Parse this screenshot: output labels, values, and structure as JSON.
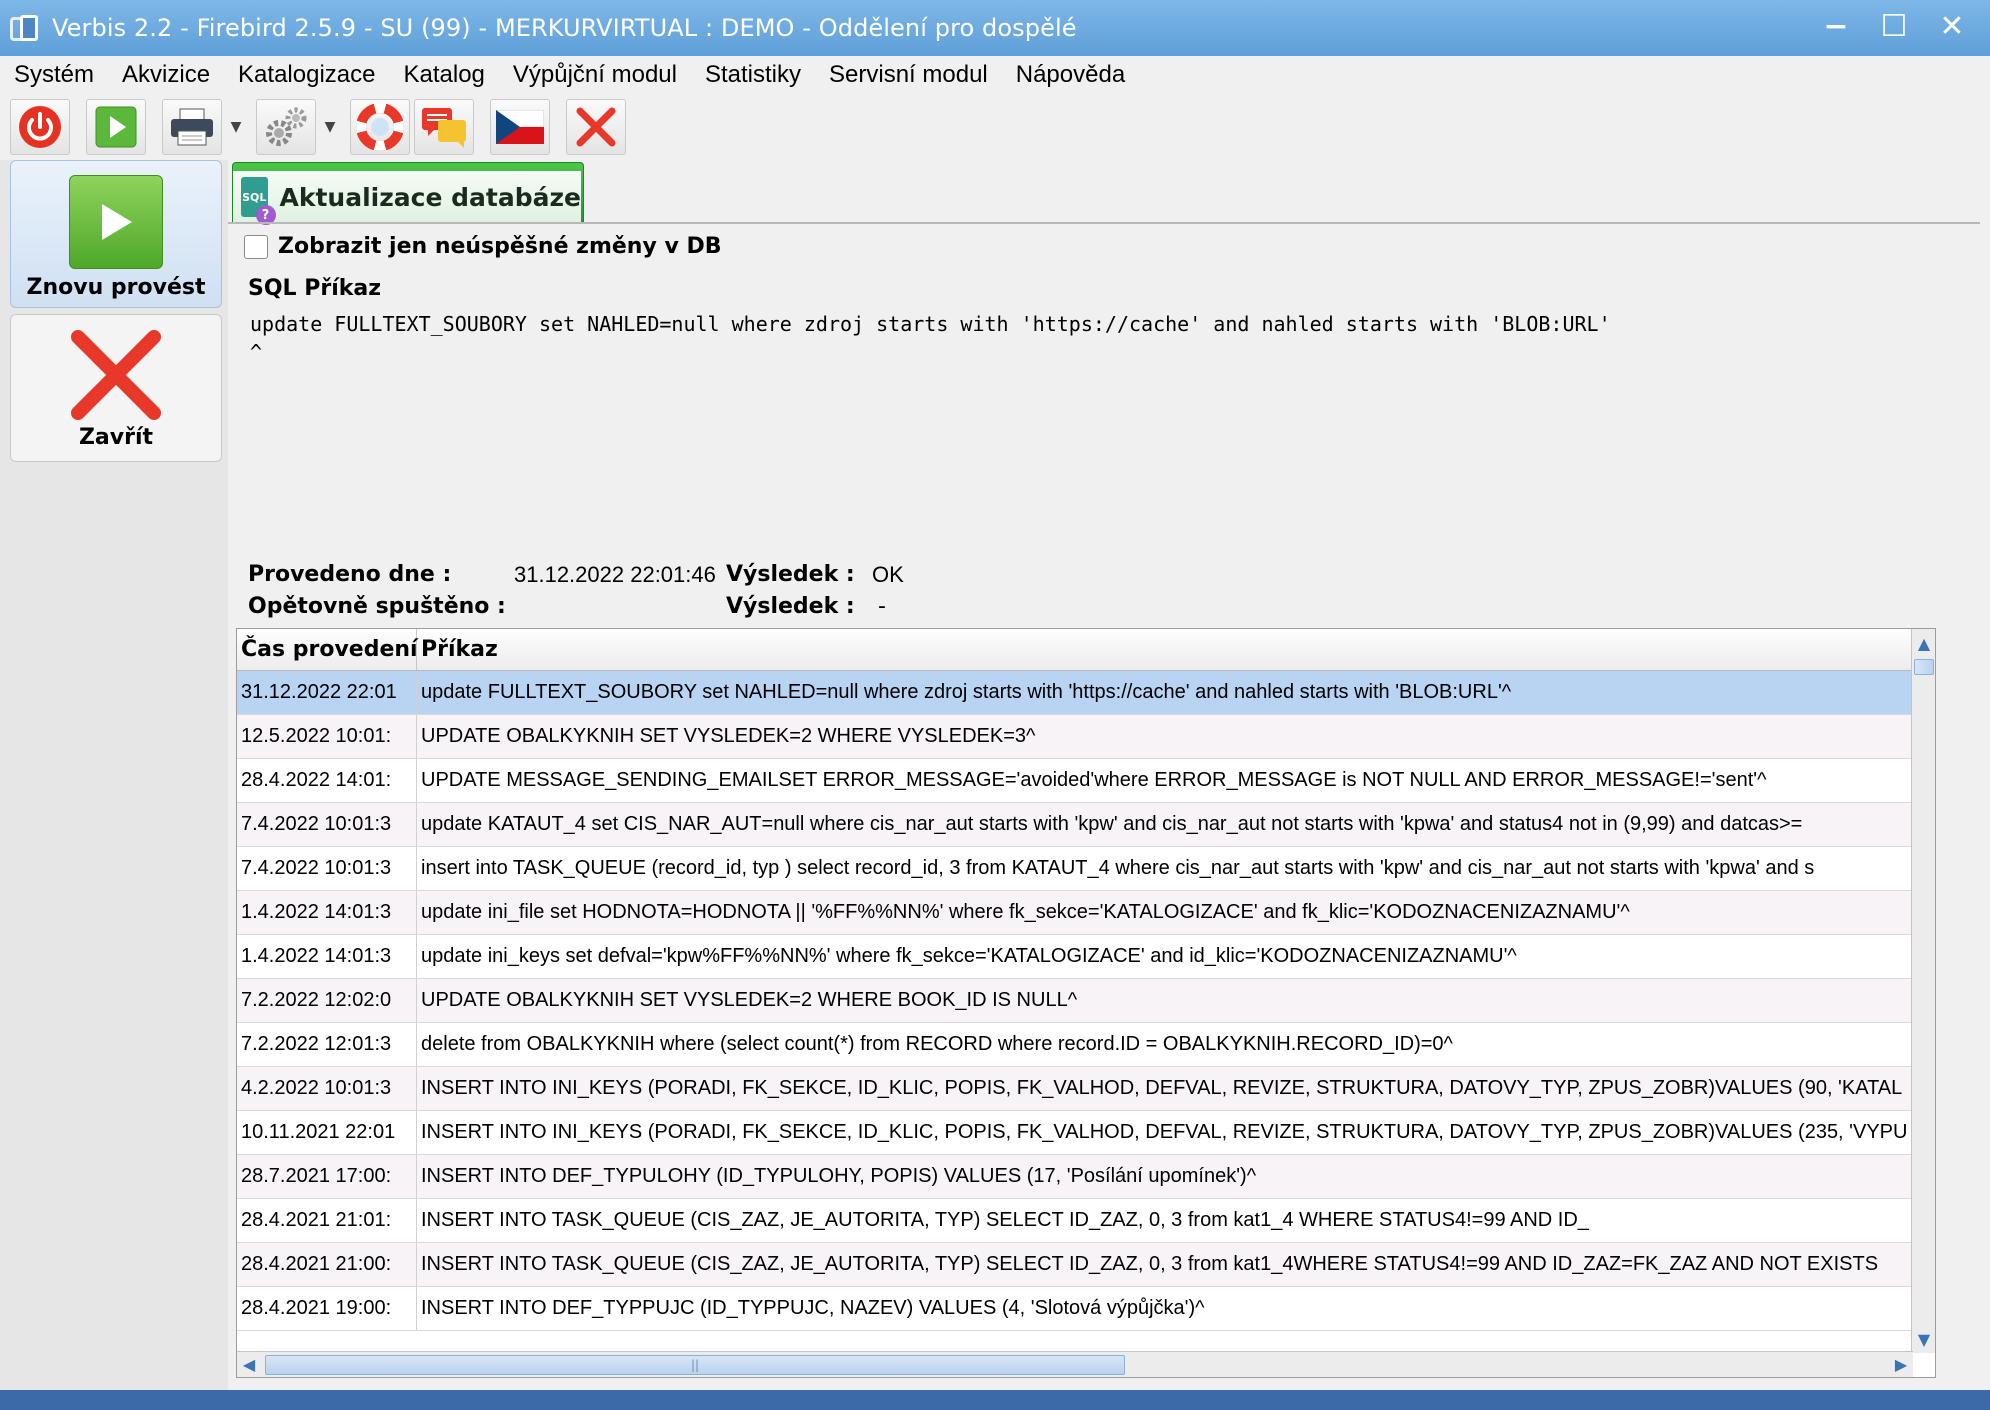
{
  "window": {
    "title": "Verbis 2.2 - Firebird 2.5.9 - SU (99) - MERKURVIRTUAL : DEMO - Oddělení pro dospělé",
    "minimize_glyph": "−",
    "maximize_glyph": "☐",
    "close_glyph": "✕"
  },
  "menu": [
    "Systém",
    "Akvizice",
    "Katalogizace",
    "Katalog",
    "Výpůjční modul",
    "Statistiky",
    "Servisní modul",
    "Nápověda"
  ],
  "toolbar": {
    "icons": [
      "power-icon",
      "play-icon",
      "printer-icon",
      "gears-icon",
      "lifebuoy-icon",
      "chat-icon",
      "czech-flag-icon",
      "close-icon"
    ],
    "colors": {
      "power": "#e53222",
      "play": "#5cb83a",
      "close": "#e8382a"
    }
  },
  "side": {
    "rerun_label": "Znovu provést",
    "close_label": "Zavřít"
  },
  "tab": {
    "label": "Aktualizace databáze",
    "icon_text": "SQL",
    "icon_badge": "?"
  },
  "filter": {
    "checkbox_label": "Zobrazit jen neúspěšné změny v DB",
    "checked": false
  },
  "sql": {
    "label": "SQL Příkaz",
    "command": "update FULLTEXT_SOUBORY set NAHLED=null where zdroj starts with 'https://cache' and nahled starts with 'BLOB:URL'\n^"
  },
  "info": {
    "executed_label": "Provedeno dne :",
    "executed_value": "31.12.2022 22:01:46",
    "result_label": "Výsledek :",
    "result_value": "OK",
    "rerun_label": "Opětovně spuštěno :",
    "rerun_value": "",
    "result2_label": "Výsledek :",
    "result2_value": "-"
  },
  "grid": {
    "columns": [
      "Čas provedení",
      "Příkaz"
    ],
    "rows": [
      {
        "time": "31.12.2022 22:01",
        "cmd": "update FULLTEXT_SOUBORY set NAHLED=null where zdroj starts with 'https://cache' and nahled starts with 'BLOB:URL'^"
      },
      {
        "time": "12.5.2022 10:01:",
        "cmd": "UPDATE OBALKYKNIH SET VYSLEDEK=2 WHERE VYSLEDEK=3^"
      },
      {
        "time": "28.4.2022 14:01:",
        "cmd": "UPDATE MESSAGE_SENDING_EMAILSET ERROR_MESSAGE='avoided'where ERROR_MESSAGE is NOT NULL  AND ERROR_MESSAGE!='sent'^"
      },
      {
        "time": "7.4.2022 10:01:3",
        "cmd": "update KATAUT_4 set CIS_NAR_AUT=null where cis_nar_aut starts with 'kpw' and cis_nar_aut not starts with 'kpwa' and status4 not in (9,99) and datcas>="
      },
      {
        "time": "7.4.2022 10:01:3",
        "cmd": "insert into TASK_QUEUE (record_id, typ ) select record_id, 3 from KATAUT_4 where cis_nar_aut starts with 'kpw' and cis_nar_aut not starts with 'kpwa' and s"
      },
      {
        "time": "1.4.2022 14:01:3",
        "cmd": "update ini_file set HODNOTA=HODNOTA || '%FF%%NN%' where fk_sekce='KATALOGIZACE' and fk_klic='KODOZNACENIZAZNAMU'^"
      },
      {
        "time": "1.4.2022 14:01:3",
        "cmd": "update ini_keys set defval='kpw%FF%%NN%' where fk_sekce='KATALOGIZACE' and id_klic='KODOZNACENIZAZNAMU'^"
      },
      {
        "time": "7.2.2022 12:02:0",
        "cmd": "UPDATE OBALKYKNIH SET VYSLEDEK=2 WHERE BOOK_ID IS NULL^"
      },
      {
        "time": "7.2.2022 12:01:3",
        "cmd": "delete from OBALKYKNIH where (select count(*) from RECORD where record.ID = OBALKYKNIH.RECORD_ID)=0^"
      },
      {
        "time": "4.2.2022 10:01:3",
        "cmd": "INSERT INTO INI_KEYS (PORADI, FK_SEKCE, ID_KLIC, POPIS, FK_VALHOD, DEFVAL, REVIZE, STRUKTURA, DATOVY_TYP, ZPUS_ZOBR)VALUES (90, 'KATAL"
      },
      {
        "time": "10.11.2021 22:01",
        "cmd": "INSERT INTO INI_KEYS (PORADI, FK_SEKCE, ID_KLIC, POPIS, FK_VALHOD, DEFVAL, REVIZE, STRUKTURA, DATOVY_TYP, ZPUS_ZOBR)VALUES (235, 'VYPU"
      },
      {
        "time": "28.7.2021 17:00:",
        "cmd": "INSERT INTO DEF_TYPULOHY (ID_TYPULOHY, POPIS)    VALUES (17, 'Posílání upomínek')^"
      },
      {
        "time": "28.4.2021 21:01:",
        "cmd": "INSERT INTO TASK_QUEUE (CIS_ZAZ, JE_AUTORITA, TYP) SELECT ID_ZAZ, 0, 3 from kat1_4                              WHERE STATUS4!=99 AND ID_"
      },
      {
        "time": "28.4.2021 21:00:",
        "cmd": "INSERT INTO TASK_QUEUE (CIS_ZAZ, JE_AUTORITA, TYP) SELECT ID_ZAZ, 0, 3 from kat1_4WHERE STATUS4!=99 AND ID_ZAZ=FK_ZAZ AND NOT EXISTS"
      },
      {
        "time": "28.4.2021 19:00:",
        "cmd": "INSERT INTO DEF_TYPPUJC (ID_TYPPUJC, NAZEV) VALUES  (4, 'Slotová výpůjčka')^"
      }
    ],
    "selected_index": 0
  }
}
